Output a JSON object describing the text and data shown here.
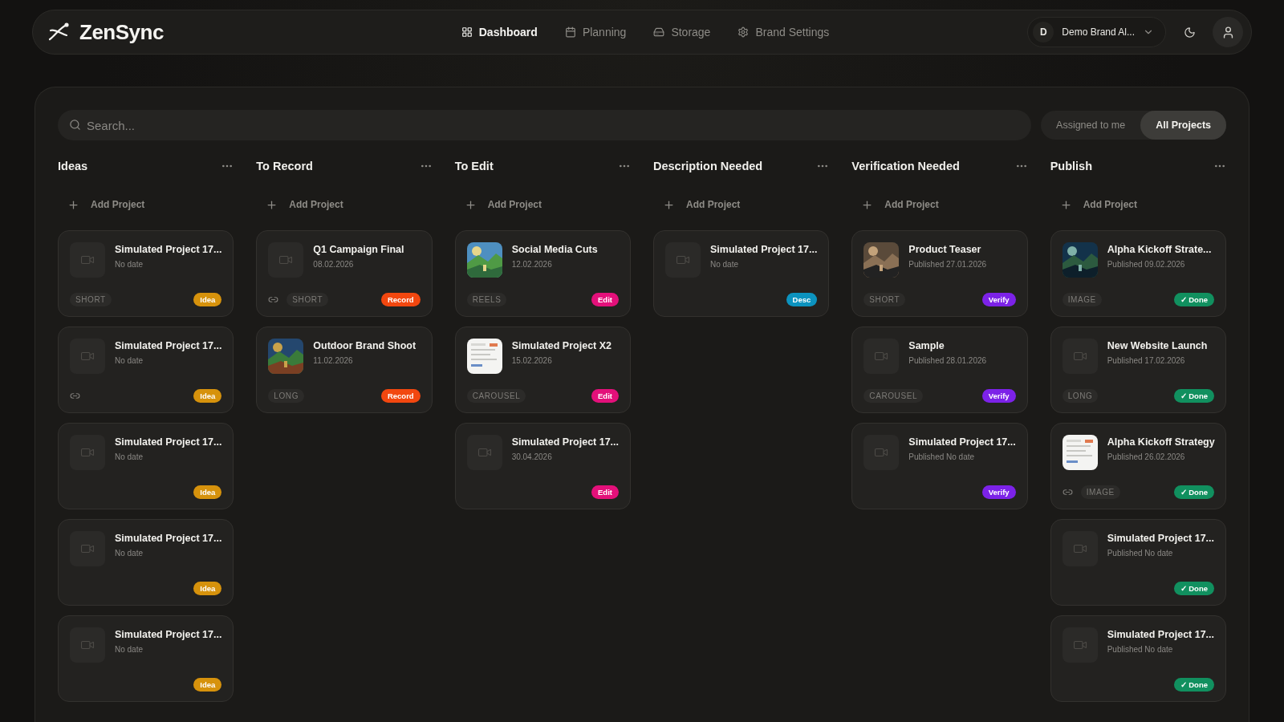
{
  "header": {
    "logo": "ZenSync",
    "nav": [
      {
        "label": "Dashboard",
        "selected": true
      },
      {
        "label": "Planning",
        "selected": false
      },
      {
        "label": "Storage",
        "selected": false
      },
      {
        "label": "Brand Settings",
        "selected": false
      }
    ],
    "brand": {
      "initial": "D",
      "name": "Demo Brand Al..."
    }
  },
  "search": {
    "placeholder": "Search..."
  },
  "filters": [
    {
      "label": "Assigned to me",
      "selected": false
    },
    {
      "label": "All Projects",
      "selected": true
    }
  ],
  "columns": [
    {
      "title": "Ideas",
      "add_label": "Add Project",
      "cards": [
        {
          "title": "Simulated Project 17...",
          "date": "No date",
          "kind": "video",
          "link": false,
          "format": "SHORT",
          "status": {
            "kind": "idea",
            "label": "Idea"
          }
        },
        {
          "title": "Simulated Project 17...",
          "date": "No date",
          "kind": "video",
          "link": true,
          "status": {
            "kind": "idea",
            "label": "Idea"
          }
        },
        {
          "title": "Simulated Project 17...",
          "date": "No date",
          "kind": "video",
          "link": false,
          "status": {
            "kind": "idea",
            "label": "Idea"
          }
        },
        {
          "title": "Simulated Project 17...",
          "date": "No date",
          "kind": "video",
          "link": false,
          "status": {
            "kind": "idea",
            "label": "Idea"
          }
        },
        {
          "title": "Simulated Project 17...",
          "date": "No date",
          "kind": "video",
          "link": false,
          "status": {
            "kind": "idea",
            "label": "Idea"
          }
        }
      ]
    },
    {
      "title": "To Record",
      "add_label": "Add Project",
      "cards": [
        {
          "title": "Q1 Campaign Final",
          "date": "08.02.2026",
          "kind": "video",
          "link": true,
          "format": "SHORT",
          "status": {
            "kind": "record",
            "label": "Record"
          }
        },
        {
          "title": "Outdoor Brand Shoot",
          "date": "11.02.2026",
          "kind": "picture",
          "link": false,
          "format": "LONG",
          "status": {
            "kind": "record",
            "label": "Record"
          }
        }
      ]
    },
    {
      "title": "To Edit",
      "add_label": "Add Project",
      "cards": [
        {
          "title": "Social Media Cuts",
          "date": "12.02.2026",
          "kind": "picture",
          "link": false,
          "format": "REELS",
          "status": {
            "kind": "edit",
            "label": "Edit"
          }
        },
        {
          "title": "Simulated Project X2",
          "date": "15.02.2026",
          "kind": "document",
          "link": false,
          "format": "CAROUSEL",
          "status": {
            "kind": "edit",
            "label": "Edit"
          }
        },
        {
          "title": "Simulated Project 17...",
          "date": "30.04.2026",
          "kind": "video",
          "link": false,
          "status": {
            "kind": "edit",
            "label": "Edit"
          }
        }
      ]
    },
    {
      "title": "Description Needed",
      "add_label": "Add Project",
      "cards": [
        {
          "title": "Simulated Project 17...",
          "date": "No date",
          "kind": "video",
          "link": false,
          "status": {
            "kind": "desc",
            "label": "Desc"
          }
        }
      ]
    },
    {
      "title": "Verification Needed",
      "add_label": "Add Project",
      "cards": [
        {
          "title": "Product Teaser",
          "date": "Published 27.01.2026",
          "kind": "picture",
          "link": false,
          "format": "SHORT",
          "status": {
            "kind": "verify",
            "label": "Verify"
          }
        },
        {
          "title": "Sample",
          "date": "Published 28.01.2026",
          "kind": "video",
          "link": false,
          "format": "CAROUSEL",
          "status": {
            "kind": "verify",
            "label": "Verify"
          }
        },
        {
          "title": "Simulated Project 17...",
          "date": "Published No date",
          "kind": "video",
          "link": false,
          "status": {
            "kind": "verify",
            "label": "Verify"
          }
        }
      ]
    },
    {
      "title": "Publish",
      "add_label": "Add Project",
      "cards": [
        {
          "title": "Alpha Kickoff Strate...",
          "date": "Published 09.02.2026",
          "kind": "picture",
          "link": false,
          "format": "IMAGE",
          "status": {
            "kind": "done",
            "label": "✓ Done"
          }
        },
        {
          "title": "New Website Launch",
          "date": "Published 17.02.2026",
          "kind": "video",
          "link": false,
          "format": "LONG",
          "status": {
            "kind": "done",
            "label": "✓ Done"
          }
        },
        {
          "title": "Alpha Kickoff Strategy",
          "date": "Published 26.02.2026",
          "kind": "document",
          "link": true,
          "format": "IMAGE",
          "status": {
            "kind": "done",
            "label": "✓ Done"
          }
        },
        {
          "title": "Simulated Project 17...",
          "date": "Published No date",
          "kind": "video",
          "link": false,
          "status": {
            "kind": "done",
            "label": "✓ Done"
          }
        },
        {
          "title": "Simulated Project 17...",
          "date": "Published No date",
          "kind": "video",
          "link": false,
          "status": {
            "kind": "done",
            "label": "✓ Done"
          }
        }
      ]
    }
  ]
}
